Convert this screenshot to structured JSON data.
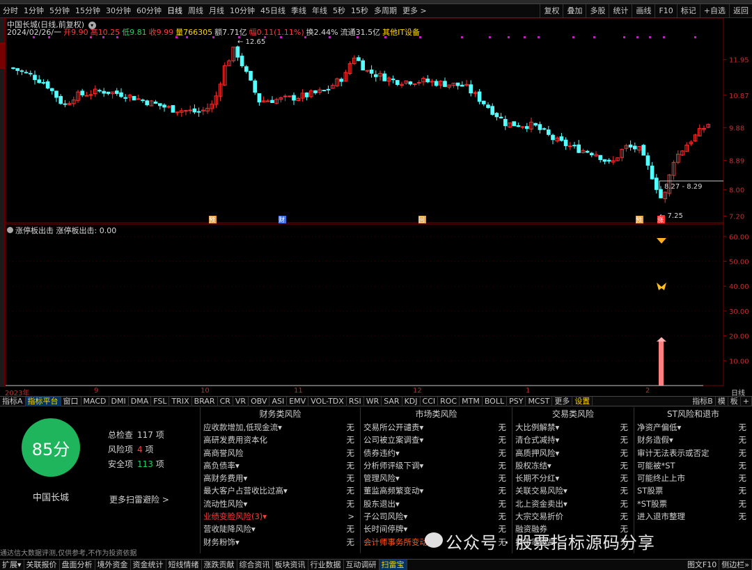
{
  "period_tabs": [
    "分时",
    "1分钟",
    "5分钟",
    "15分钟",
    "30分钟",
    "60分钟",
    "日线",
    "周线",
    "月线",
    "10分钟",
    "45日线",
    "季线",
    "年线",
    "5秒",
    "15秒",
    "多周期",
    "更多 >"
  ],
  "active_period": "日线",
  "right_buttons": [
    "复权",
    "叠加",
    "多股",
    "统计",
    "画线",
    "F10",
    "标记",
    "+自选",
    "返回"
  ],
  "stock": {
    "title": "中国长城(日线,前复权)",
    "date": "2024/02/26/一",
    "open_label": "开",
    "open": "9.90",
    "high_label": "高",
    "high": "10.25",
    "low_label": "低",
    "low": "9.81",
    "close_label": "收",
    "close": "9.99",
    "vol_label": "量",
    "vol": "766305",
    "amt_label": "额",
    "amt": "7.71亿",
    "chg_label": "幅",
    "chg": "0.11(1.11%)",
    "turn_label": "换",
    "turn": "2.44%",
    "float_label": "流通",
    "float": "31.5亿",
    "sector": "其他IT设备"
  },
  "price_axis": [
    "11.95",
    "10.87",
    "9.88",
    "8.89",
    "8.00",
    "7.20"
  ],
  "annot_high": "12.65",
  "annot_low": "7.25",
  "annot_range": "8.27 - 8.29",
  "event_markers": [
    "预",
    "财",
    "回",
    "预",
    "涨"
  ],
  "indicator": {
    "title": "涨停板出击 涨停板出击: 0.00",
    "axis": [
      "60.00",
      "50.00",
      "40.00",
      "30.00",
      "20.00",
      "10.00"
    ]
  },
  "date_labels": [
    "2023年",
    "9",
    "10",
    "11",
    "12",
    "1",
    "2"
  ],
  "right_corner": "日线",
  "indicator_tabs": [
    "指标A",
    "指标平台",
    "窗口",
    "MACD",
    "DMI",
    "DMA",
    "FSL",
    "TRIX",
    "BRAR",
    "CR",
    "VR",
    "OBV",
    "ASI",
    "EMV",
    "VOL-TDX",
    "RSI",
    "WR",
    "SAR",
    "KDJ",
    "CCI",
    "ROC",
    "MTM",
    "BOLL",
    "PSY",
    "MCST",
    "更多",
    "设置"
  ],
  "indicator_right": [
    "指标B",
    "模",
    "板",
    "+"
  ],
  "score": {
    "value": "85分",
    "name": "中国长城",
    "total_label": "总检查",
    "total": "117",
    "total_unit": "项",
    "risk_label": "风险项",
    "risk": "4",
    "risk_unit": "项",
    "safe_label": "安全项",
    "safe": "113",
    "safe_unit": "项",
    "more": "更多扫雷避险 >",
    "disclaimer": "通达信大数据评测,仅供参考,不作为投资依据"
  },
  "columns": [
    {
      "title": "财务类风险",
      "rows": [
        [
          "应收款增加,低现金流▾",
          "无"
        ],
        [
          "高研发费用资本化",
          "无"
        ],
        [
          "高商誉风险",
          "无"
        ],
        [
          "高负债率▾",
          "无"
        ],
        [
          "高财务费用▾",
          "无"
        ],
        [
          "最大客户占营收比过高▾",
          "无"
        ],
        [
          "流动性风险▾",
          "无"
        ],
        [
          "业绩变脸风险(3)▾",
          ">"
        ],
        [
          "营收陡降风险▾",
          "无"
        ],
        [
          "财务粉饰▾",
          "无"
        ]
      ]
    },
    {
      "title": "市场类风险",
      "rows": [
        [
          "交易所公开谴责▾",
          "无"
        ],
        [
          "公司被立案调查▾",
          "无"
        ],
        [
          "债券违约▾",
          "无"
        ],
        [
          "分析师评级下调▾",
          "无"
        ],
        [
          "管理风险▾",
          "无"
        ],
        [
          "董监高频繁变动▾",
          "无"
        ],
        [
          "股东退出▾",
          "无"
        ],
        [
          "子公司风险▾",
          "无"
        ],
        [
          "长时间停牌▾",
          "无"
        ],
        [
          "会计师事务所变动▾",
          "无"
        ]
      ]
    },
    {
      "title": "交易类风险",
      "rows": [
        [
          "大比例解禁▾",
          "无"
        ],
        [
          "清仓式减持▾",
          "无"
        ],
        [
          "高质押风险▾",
          "无"
        ],
        [
          "股权冻结▾",
          "无"
        ],
        [
          "长期不分红▾",
          "无"
        ],
        [
          "关联交易风险▾",
          "无"
        ],
        [
          "北上资金卖出▾",
          "无"
        ],
        [
          "大宗交易折价",
          "无"
        ],
        [
          "融资融券",
          "无"
        ],
        [
          "换手率过高",
          "无"
        ]
      ]
    },
    {
      "title": "ST风险和退市",
      "rows": [
        [
          "净资产偏低▾",
          "无"
        ],
        [
          "财务造假▾",
          "无"
        ],
        [
          "审计无法表示或否定",
          "无"
        ],
        [
          "可能被*ST",
          "无"
        ],
        [
          "可能终止上市",
          "无"
        ],
        [
          "ST股票",
          "无"
        ],
        [
          "*ST股票",
          "无"
        ],
        [
          "进入退市整理",
          "无"
        ]
      ]
    }
  ],
  "watermark": "公众号 · 股票指标源码分享",
  "bottom_tabs": [
    "扩展▾",
    "关联报价",
    "盘面分析",
    "境外资金",
    "资金统计",
    "短线情绪",
    "涨跌贡献",
    "综合资讯",
    "板块资讯",
    "行业数据",
    "互动调研",
    "扫雷宝"
  ],
  "bottom_right": [
    "图文F10",
    "侧边栏»"
  ],
  "colors": {
    "up": "#ff3030",
    "down": "#54ffff",
    "accent": "#ffd700",
    "score": "#1fb55c"
  }
}
